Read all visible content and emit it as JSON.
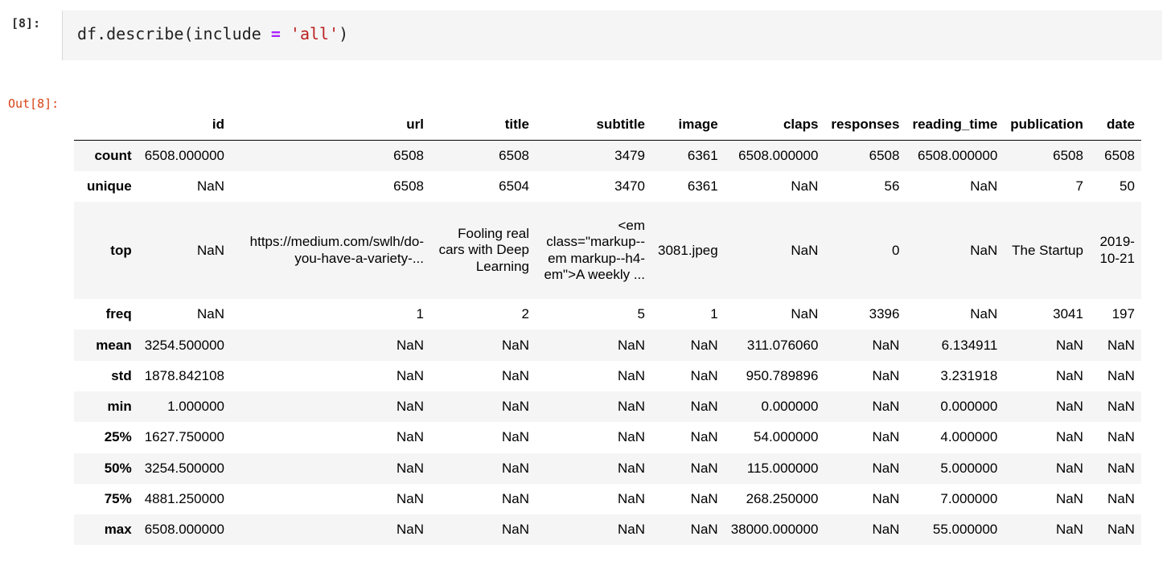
{
  "cell": {
    "in_prompt": "[8]:",
    "code": {
      "prefix": "df.describe(include ",
      "operator": "=",
      "space": " ",
      "string": "'all'",
      "suffix": ")"
    },
    "out_prompt": "Out[8]:"
  },
  "table": {
    "index_header": "",
    "columns": [
      "id",
      "url",
      "title",
      "subtitle",
      "image",
      "claps",
      "responses",
      "reading_time",
      "publication",
      "date"
    ],
    "rows": [
      {
        "label": "count",
        "cells": [
          "6508.000000",
          "6508",
          "6508",
          "3479",
          "6361",
          "6508.000000",
          "6508",
          "6508.000000",
          "6508",
          "6508"
        ]
      },
      {
        "label": "unique",
        "cells": [
          "NaN",
          "6508",
          "6504",
          "3470",
          "6361",
          "NaN",
          "56",
          "NaN",
          "7",
          "50"
        ]
      },
      {
        "label": "top",
        "cells": [
          "NaN",
          "https://medium.com/swlh/do-you-have-a-variety-...",
          "Fooling real cars with Deep Learning",
          "<em class=\"markup--em markup--h4-em\">A weekly ...",
          "3081.jpeg",
          "NaN",
          "0",
          "NaN",
          "The Startup",
          "2019-10-21"
        ]
      },
      {
        "label": "freq",
        "cells": [
          "NaN",
          "1",
          "2",
          "5",
          "1",
          "NaN",
          "3396",
          "NaN",
          "3041",
          "197"
        ]
      },
      {
        "label": "mean",
        "cells": [
          "3254.500000",
          "NaN",
          "NaN",
          "NaN",
          "NaN",
          "311.076060",
          "NaN",
          "6.134911",
          "NaN",
          "NaN"
        ]
      },
      {
        "label": "std",
        "cells": [
          "1878.842108",
          "NaN",
          "NaN",
          "NaN",
          "NaN",
          "950.789896",
          "NaN",
          "3.231918",
          "NaN",
          "NaN"
        ]
      },
      {
        "label": "min",
        "cells": [
          "1.000000",
          "NaN",
          "NaN",
          "NaN",
          "NaN",
          "0.000000",
          "NaN",
          "0.000000",
          "NaN",
          "NaN"
        ]
      },
      {
        "label": "25%",
        "cells": [
          "1627.750000",
          "NaN",
          "NaN",
          "NaN",
          "NaN",
          "54.000000",
          "NaN",
          "4.000000",
          "NaN",
          "NaN"
        ]
      },
      {
        "label": "50%",
        "cells": [
          "3254.500000",
          "NaN",
          "NaN",
          "NaN",
          "NaN",
          "115.000000",
          "NaN",
          "5.000000",
          "NaN",
          "NaN"
        ]
      },
      {
        "label": "75%",
        "cells": [
          "4881.250000",
          "NaN",
          "NaN",
          "NaN",
          "NaN",
          "268.250000",
          "NaN",
          "7.000000",
          "NaN",
          "NaN"
        ]
      },
      {
        "label": "max",
        "cells": [
          "6508.000000",
          "NaN",
          "NaN",
          "NaN",
          "NaN",
          "38000.000000",
          "NaN",
          "55.000000",
          "NaN",
          "NaN"
        ]
      }
    ]
  }
}
